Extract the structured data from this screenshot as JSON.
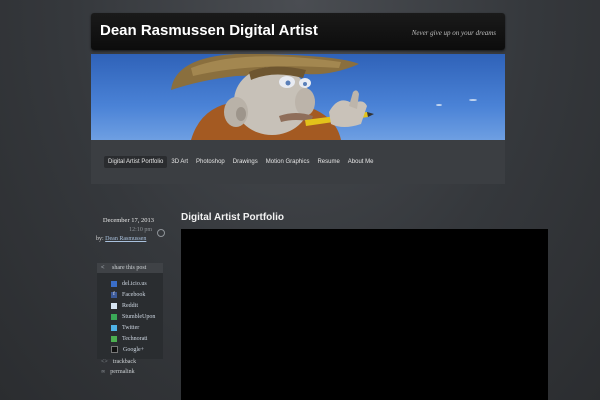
{
  "site": {
    "title": "Dean Rasmussen Digital Artist",
    "tagline": "Never give up on your dreams"
  },
  "nav": {
    "items": [
      {
        "label": "Digital Artist Portfolio",
        "active": true
      },
      {
        "label": "3D Art"
      },
      {
        "label": "Photoshop"
      },
      {
        "label": "Drawings"
      },
      {
        "label": "Motion Graphics"
      },
      {
        "label": "Resume"
      },
      {
        "label": "About Me"
      }
    ]
  },
  "post": {
    "date": "December 17, 2013",
    "time": "12:10 pm",
    "by_label": "by:",
    "author": "Dean Rasmussen",
    "title": "Digital Artist Portfolio"
  },
  "share": {
    "heading": "share this post",
    "items": [
      {
        "label": "del.icio.us",
        "icon": "delicious-icon",
        "color": "#3a6ec8"
      },
      {
        "label": "Facebook",
        "icon": "facebook-icon",
        "color": "#3b5998"
      },
      {
        "label": "Reddit",
        "icon": "reddit-icon",
        "color": "#d6e4f2"
      },
      {
        "label": "StumbleUpon",
        "icon": "stumbleupon-icon",
        "color": "#3aa857"
      },
      {
        "label": "Twitter",
        "icon": "twitter-icon",
        "color": "#4fb3e6"
      },
      {
        "label": "Technorati",
        "icon": "technorati-icon",
        "color": "#4caf50"
      },
      {
        "label": "Google+",
        "icon": "google-plus-icon",
        "color": "#111111"
      }
    ],
    "trackback": "trackback",
    "permalink": "permalink"
  },
  "colors": {
    "header_bg": "#0c0c0c",
    "sky": "#4a82d6",
    "hat": "#8a6f3e",
    "pencil": "#e3c21a"
  }
}
